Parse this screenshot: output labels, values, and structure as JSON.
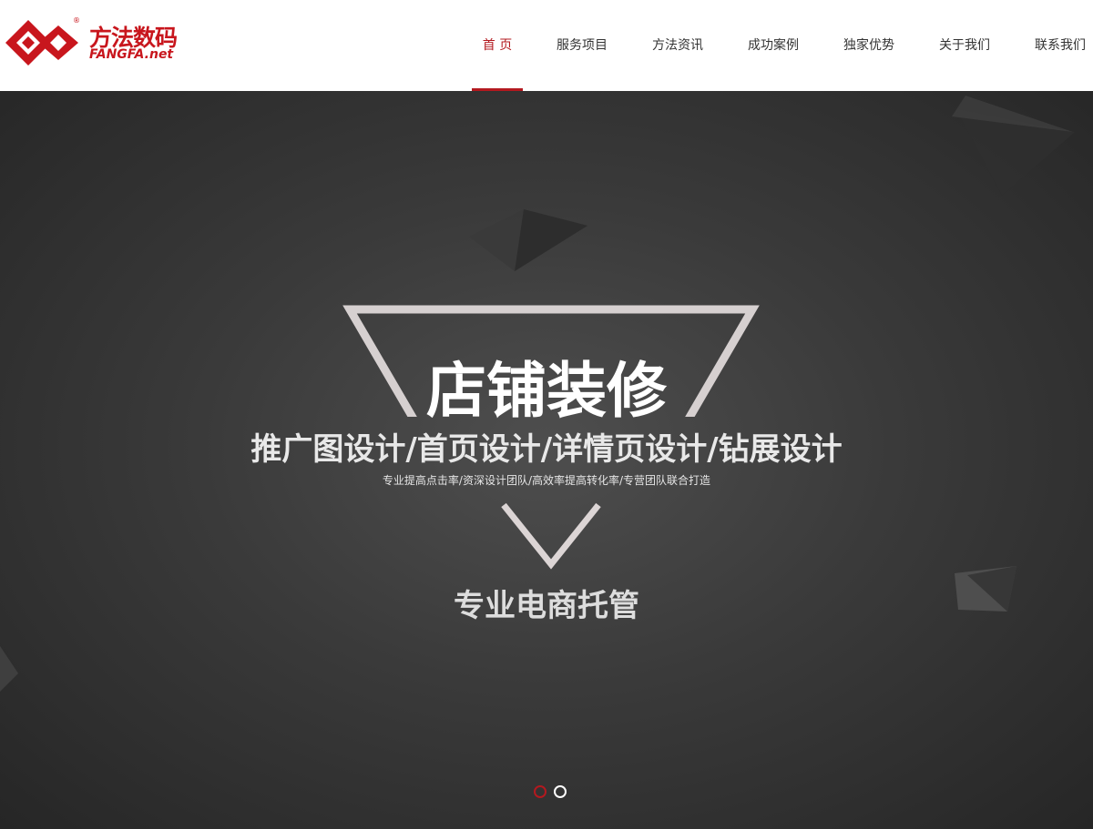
{
  "brand": {
    "name_cn": "方法数码",
    "name_en": "FANGFA.net",
    "reg_mark": "®",
    "color": "#c8161d"
  },
  "nav": {
    "active_color": "#b3191f",
    "items": [
      {
        "label": "首 页",
        "active": true
      },
      {
        "label": "服务项目",
        "active": false
      },
      {
        "label": "方法资讯",
        "active": false
      },
      {
        "label": "成功案例",
        "active": false
      },
      {
        "label": "独家优势",
        "active": false
      },
      {
        "label": "关于我们",
        "active": false
      },
      {
        "label": "联系我们",
        "active": false
      }
    ]
  },
  "banner": {
    "headline": "店铺装修",
    "subhead": "推广图设计/首页设计/详情页设计/钻展设计",
    "tagline": "专业提高点击率/资深设计团队/高效率提高转化率/专营团队联合打造",
    "footer": "专业电商托管",
    "slides": {
      "count": 2,
      "active_index": 0
    }
  }
}
